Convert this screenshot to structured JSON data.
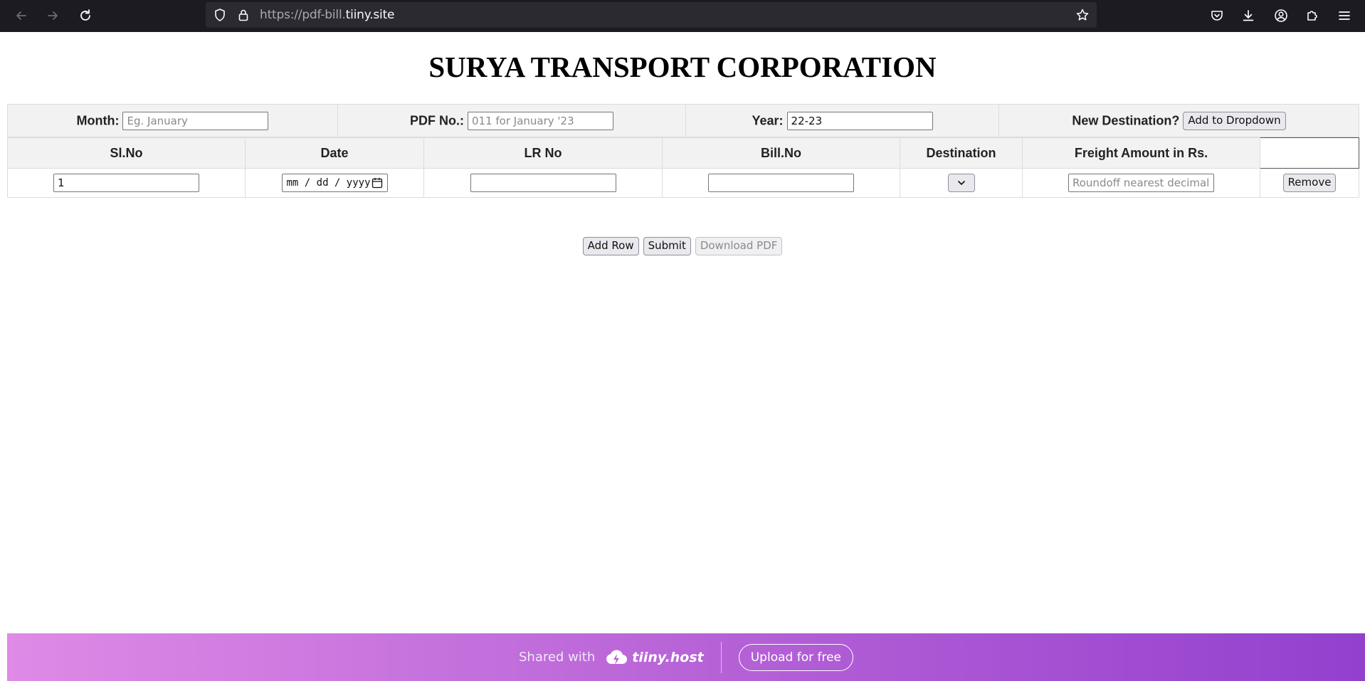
{
  "browser": {
    "url_prefix": "https://pdf-bill.",
    "url_domain": "tiiny.site"
  },
  "page": {
    "title": "SURYA TRANSPORT CORPORATION"
  },
  "top_form": {
    "month_label": "Month:",
    "month_placeholder": "Eg. January",
    "pdf_label": "PDF No.:",
    "pdf_placeholder": "011 for January '23",
    "year_label": "Year:",
    "year_value": "22-23",
    "new_dest_label": "New Destination?",
    "add_dropdown_label": "Add to Dropdown"
  },
  "table": {
    "headers": [
      "Sl.No",
      "Date",
      "LR No",
      "Bill.No",
      "Destination",
      "Freight Amount in Rs."
    ],
    "row": {
      "sl_no": "1",
      "date_placeholder": "mm / dd / yyyy",
      "freight_placeholder": "Roundoff nearest decimal",
      "remove_label": "Remove"
    }
  },
  "actions": {
    "add_row": "Add Row",
    "submit": "Submit",
    "download_pdf": "Download PDF"
  },
  "footer": {
    "shared_with": "Shared with",
    "brand": "tiiny.host",
    "upload": "Upload for free"
  }
}
